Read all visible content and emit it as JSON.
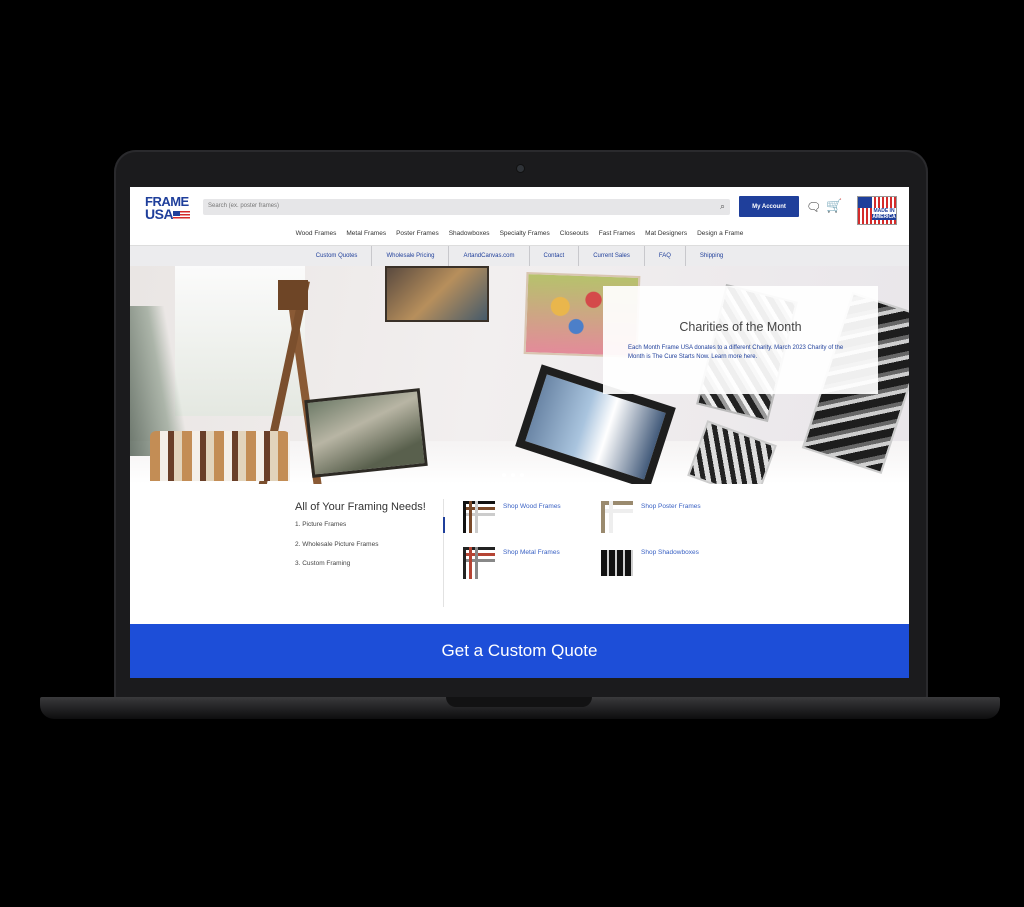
{
  "header": {
    "logo": {
      "line1": "FRAME",
      "line2": "USA"
    },
    "search": {
      "placeholder": "Search (ex. poster frames)"
    },
    "account_label": "My Account",
    "badge": {
      "line1": "MADE IN",
      "line2": "AMERICA"
    }
  },
  "nav": {
    "items": [
      "Wood Frames",
      "Metal Frames",
      "Poster Frames",
      "Shadowboxes",
      "Specialty Frames",
      "Closeouts",
      "Fast Frames",
      "Mat Designers",
      "Design a Frame"
    ]
  },
  "subnav": {
    "items": [
      "Custom Quotes",
      "Wholesale Pricing",
      "ArtandCanvas.com",
      "Contact",
      "Current Sales",
      "FAQ",
      "Shipping"
    ]
  },
  "hero": {
    "title": "Charities of the Month",
    "text": "Each Month Frame USA donates to a different Charity. March 2023 Charity of the Month is The Cure Starts Now. Learn more here."
  },
  "needs": {
    "title": "All of Your Framing Needs!",
    "list": [
      "1.  Picture Frames",
      "2.  Wholesale Picture Frames",
      "3.  Custom Framing"
    ],
    "shop": [
      {
        "label": "Shop Wood Frames",
        "icon": "wood-frame-corners"
      },
      {
        "label": "Shop Poster Frames",
        "icon": "poster-frame-corners"
      },
      {
        "label": "Shop Metal Frames",
        "icon": "metal-frame-corners"
      },
      {
        "label": "Shop Shadowboxes",
        "icon": "shadowbox-frames"
      }
    ]
  },
  "cta": {
    "label": "Get a Custom Quote"
  },
  "colors": {
    "brand_blue": "#1f3f9b",
    "cta_blue": "#1d4ed8",
    "link_blue": "#3a62c4"
  }
}
